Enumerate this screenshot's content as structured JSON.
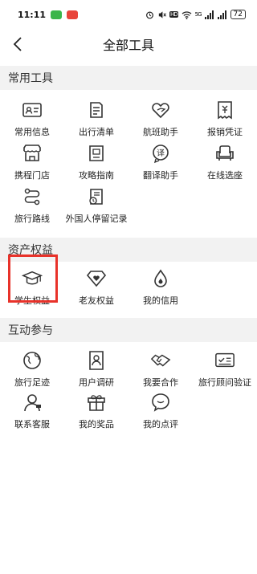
{
  "status": {
    "time": "11:11",
    "hd": "HD",
    "signal": "5G",
    "battery": "72"
  },
  "nav": {
    "title": "全部工具"
  },
  "sections": {
    "common": {
      "title": "常用工具",
      "items": [
        {
          "label": "常用信息",
          "icon": "id-card-icon"
        },
        {
          "label": "出行清单",
          "icon": "checklist-icon"
        },
        {
          "label": "航班助手",
          "icon": "plane-heart-icon"
        },
        {
          "label": "报销凭证",
          "icon": "receipt-icon"
        },
        {
          "label": "携程门店",
          "icon": "store-icon"
        },
        {
          "label": "攻略指南",
          "icon": "guide-book-icon"
        },
        {
          "label": "翻译助手",
          "icon": "translate-icon"
        },
        {
          "label": "在线选座",
          "icon": "seat-icon"
        },
        {
          "label": "旅行路线",
          "icon": "route-icon"
        },
        {
          "label": "外国人停留记录",
          "icon": "stay-record-icon"
        }
      ]
    },
    "assets": {
      "title": "资产权益",
      "items": [
        {
          "label": "学生权益",
          "icon": "graduation-cap-icon"
        },
        {
          "label": "老友权益",
          "icon": "diamond-heart-icon"
        },
        {
          "label": "我的信用",
          "icon": "credit-drop-icon"
        }
      ]
    },
    "interaction": {
      "title": "互动参与",
      "items": [
        {
          "label": "旅行足迹",
          "icon": "globe-icon"
        },
        {
          "label": "用户调研",
          "icon": "survey-icon"
        },
        {
          "label": "我要合作",
          "icon": "handshake-icon"
        },
        {
          "label": "旅行顾问验证",
          "icon": "advisor-verify-icon"
        },
        {
          "label": "联系客服",
          "icon": "customer-service-icon"
        },
        {
          "label": "我的奖品",
          "icon": "gift-icon"
        },
        {
          "label": "我的点评",
          "icon": "comment-icon"
        }
      ]
    }
  }
}
